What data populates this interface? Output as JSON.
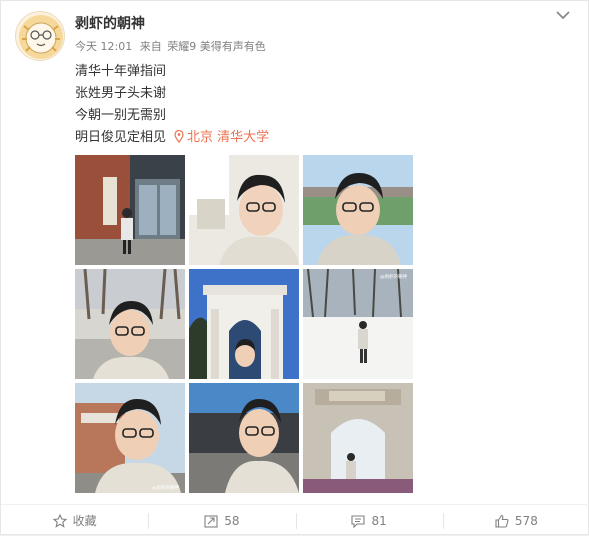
{
  "post": {
    "username": "剥虾的朝神",
    "time": "今天 12:01",
    "source_prefix": "来自",
    "device": "荣耀9 美得有声有色",
    "lines": [
      "清华十年弹指间",
      "张姓男子头未谢",
      "今朝一别无需别",
      "明日俊见定相见"
    ],
    "location": "北京 清华大学",
    "watermark": "@剥虾的朝神"
  },
  "photos": [
    {
      "name": "photo-building-entrance"
    },
    {
      "name": "photo-selfie-indoor"
    },
    {
      "name": "photo-selfie-field"
    },
    {
      "name": "photo-selfie-avenue"
    },
    {
      "name": "photo-tsinghua-gate"
    },
    {
      "name": "photo-snow-field"
    },
    {
      "name": "photo-selfie-building"
    },
    {
      "name": "photo-selfie-street"
    },
    {
      "name": "photo-old-gate"
    }
  ],
  "actions": {
    "favorite_label": "收藏",
    "repost_count": "58",
    "comment_count": "81",
    "like_count": "578"
  },
  "colors": {
    "link_orange": "#eb7350",
    "meta_gray": "#808080"
  },
  "icons": [
    "lion-avatar-icon",
    "chevron-down-icon",
    "location-pin-icon",
    "star-icon",
    "repost-icon",
    "comment-icon",
    "thumbs-up-icon"
  ]
}
